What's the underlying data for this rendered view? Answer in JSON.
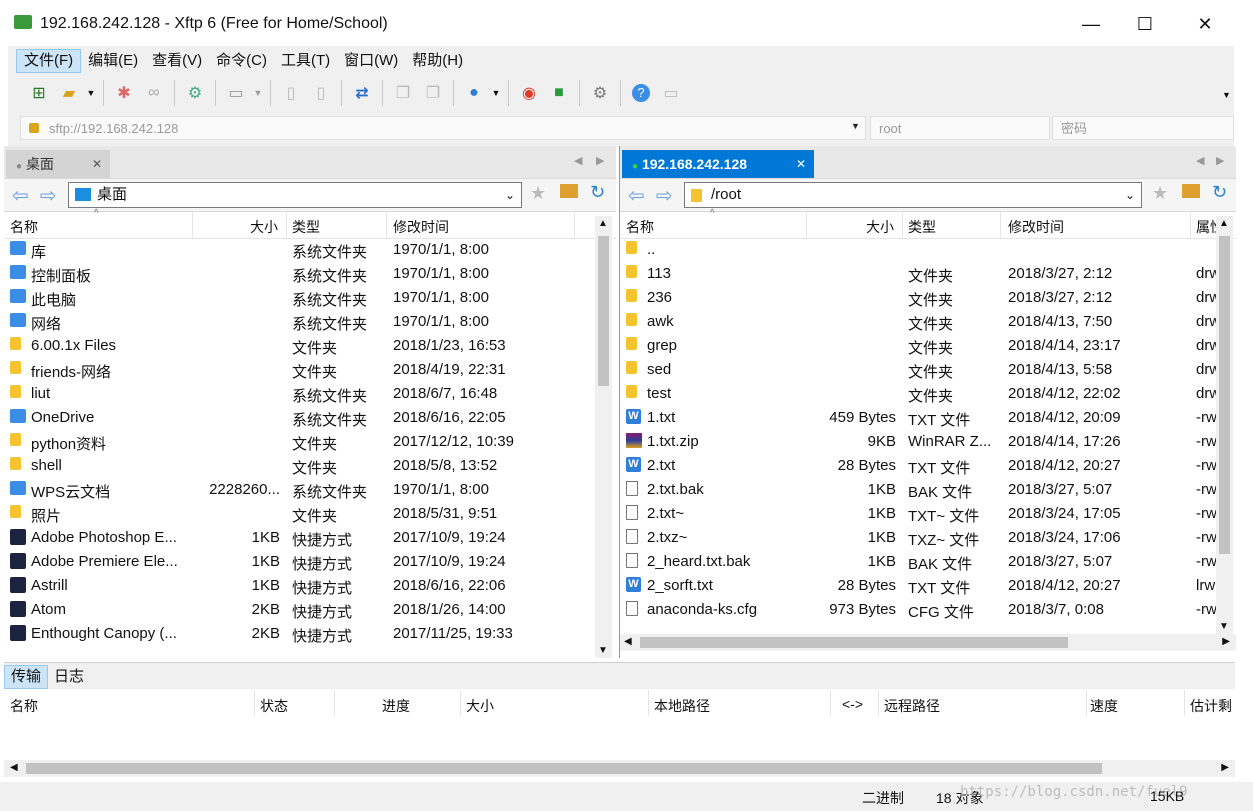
{
  "window": {
    "title": "192.168.242.128   - Xftp 6 (Free for Home/School)",
    "minimize": "—",
    "maximize": "☐",
    "close": "✕"
  },
  "menu": [
    "文件(F)",
    "编辑(E)",
    "查看(V)",
    "命令(C)",
    "工具(T)",
    "窗口(W)",
    "帮助(H)"
  ],
  "address": {
    "url_placeholder": "sftp://192.168.242.128",
    "user_placeholder": "root",
    "password_placeholder": "密码"
  },
  "left_pane": {
    "tab_label": "桌面",
    "path": "桌面",
    "columns": [
      "名称",
      "大小",
      "类型",
      "修改时间"
    ],
    "files": [
      {
        "name": "库",
        "size": "",
        "type": "系统文件夹",
        "modified": "1970/1/1, 8:00",
        "icon": "library-icon"
      },
      {
        "name": "控制面板",
        "size": "",
        "type": "系统文件夹",
        "modified": "1970/1/1, 8:00",
        "icon": "control-panel-icon"
      },
      {
        "name": "此电脑",
        "size": "",
        "type": "系统文件夹",
        "modified": "1970/1/1, 8:00",
        "icon": "computer-icon"
      },
      {
        "name": "网络",
        "size": "",
        "type": "系统文件夹",
        "modified": "1970/1/1, 8:00",
        "icon": "network-icon"
      },
      {
        "name": "6.00.1x Files",
        "size": "",
        "type": "文件夹",
        "modified": "2018/1/23, 16:53",
        "icon": "folder-icon"
      },
      {
        "name": "friends-网络",
        "size": "",
        "type": "文件夹",
        "modified": "2018/4/19, 22:31",
        "icon": "folder-icon"
      },
      {
        "name": "liut",
        "size": "",
        "type": "系统文件夹",
        "modified": "2018/6/7, 16:48",
        "icon": "user-folder-icon"
      },
      {
        "name": "OneDrive",
        "size": "",
        "type": "系统文件夹",
        "modified": "2018/6/16, 22:05",
        "icon": "onedrive-icon"
      },
      {
        "name": "python资料",
        "size": "",
        "type": "文件夹",
        "modified": "2017/12/12, 10:39",
        "icon": "folder-icon"
      },
      {
        "name": "shell",
        "size": "",
        "type": "文件夹",
        "modified": "2018/5/8, 13:52",
        "icon": "folder-icon"
      },
      {
        "name": "WPS云文档",
        "size": "2228260...",
        "type": "系统文件夹",
        "modified": "1970/1/1, 8:00",
        "icon": "cloud-icon"
      },
      {
        "name": "照片",
        "size": "",
        "type": "文件夹",
        "modified": "2018/5/31, 9:51",
        "icon": "folder-icon"
      },
      {
        "name": "Adobe Photoshop E...",
        "size": "1KB",
        "type": "快捷方式",
        "modified": "2017/10/9, 19:24",
        "icon": "shortcut-icon"
      },
      {
        "name": "Adobe Premiere Ele...",
        "size": "1KB",
        "type": "快捷方式",
        "modified": "2017/10/9, 19:24",
        "icon": "shortcut-icon"
      },
      {
        "name": "Astrill",
        "size": "1KB",
        "type": "快捷方式",
        "modified": "2018/6/16, 22:06",
        "icon": "shortcut-icon"
      },
      {
        "name": "Atom",
        "size": "2KB",
        "type": "快捷方式",
        "modified": "2018/1/26, 14:00",
        "icon": "shortcut-icon"
      },
      {
        "name": "Enthought Canopy (...",
        "size": "2KB",
        "type": "快捷方式",
        "modified": "2017/11/25, 19:33",
        "icon": "shortcut-icon"
      }
    ]
  },
  "right_pane": {
    "tab_label": "192.168.242.128",
    "path": "/root",
    "columns": [
      "名称",
      "大小",
      "类型",
      "修改时间",
      "属性"
    ],
    "files": [
      {
        "name": "..",
        "size": "",
        "type": "",
        "modified": "",
        "attr": "",
        "icon": "folder-icon"
      },
      {
        "name": "113",
        "size": "",
        "type": "文件夹",
        "modified": "2018/3/27, 2:12",
        "attr": "drw",
        "icon": "folder-icon"
      },
      {
        "name": "236",
        "size": "",
        "type": "文件夹",
        "modified": "2018/3/27, 2:12",
        "attr": "drw",
        "icon": "folder-icon"
      },
      {
        "name": "awk",
        "size": "",
        "type": "文件夹",
        "modified": "2018/4/13, 7:50",
        "attr": "drw",
        "icon": "folder-icon"
      },
      {
        "name": "grep",
        "size": "",
        "type": "文件夹",
        "modified": "2018/4/14, 23:17",
        "attr": "drw",
        "icon": "folder-icon"
      },
      {
        "name": "sed",
        "size": "",
        "type": "文件夹",
        "modified": "2018/4/13, 5:58",
        "attr": "drw",
        "icon": "folder-icon"
      },
      {
        "name": "test",
        "size": "",
        "type": "文件夹",
        "modified": "2018/4/12, 22:02",
        "attr": "drw",
        "icon": "folder-icon"
      },
      {
        "name": "1.txt",
        "size": "459 Bytes",
        "type": "TXT 文件",
        "modified": "2018/4/12, 20:09",
        "attr": "-rw",
        "icon": "txt-icon"
      },
      {
        "name": "1.txt.zip",
        "size": "9KB",
        "type": "WinRAR Z...",
        "modified": "2018/4/14, 17:26",
        "attr": "-rw",
        "icon": "rar-icon"
      },
      {
        "name": "2.txt",
        "size": "28 Bytes",
        "type": "TXT 文件",
        "modified": "2018/4/12, 20:27",
        "attr": "-rw",
        "icon": "txt-icon"
      },
      {
        "name": "2.txt.bak",
        "size": "1KB",
        "type": "BAK 文件",
        "modified": "2018/3/27, 5:07",
        "attr": "-rw",
        "icon": "file-icon"
      },
      {
        "name": "2.txt~",
        "size": "1KB",
        "type": "TXT~ 文件",
        "modified": "2018/3/24, 17:05",
        "attr": "-rw",
        "icon": "file-icon"
      },
      {
        "name": "2.txz~",
        "size": "1KB",
        "type": "TXZ~ 文件",
        "modified": "2018/3/24, 17:06",
        "attr": "-rw",
        "icon": "file-icon"
      },
      {
        "name": "2_heard.txt.bak",
        "size": "1KB",
        "type": "BAK 文件",
        "modified": "2018/3/27, 5:07",
        "attr": "-rw",
        "icon": "file-icon"
      },
      {
        "name": "2_sorft.txt",
        "size": "28 Bytes",
        "type": "TXT 文件",
        "modified": "2018/4/12, 20:27",
        "attr": "lrw",
        "icon": "txt-icon"
      },
      {
        "name": "anaconda-ks.cfg",
        "size": "973 Bytes",
        "type": "CFG 文件",
        "modified": "2018/3/7, 0:08",
        "attr": "-rw",
        "icon": "file-icon"
      }
    ]
  },
  "transfer": {
    "tabs": [
      "传输",
      "日志"
    ],
    "columns": [
      "名称",
      "状态",
      "进度",
      "大小",
      "本地路径",
      "<->",
      "远程路径",
      "速度",
      "估计剩"
    ]
  },
  "status": {
    "mode": "二进制",
    "objects": "18 对象",
    "size": "15KB",
    "watermark": "https://blog.csdn.net/fuel9"
  }
}
